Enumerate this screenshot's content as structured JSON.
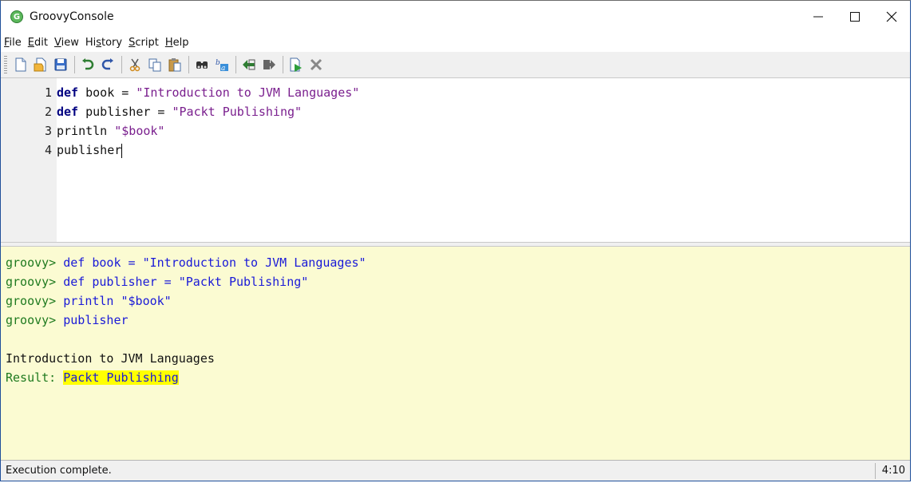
{
  "window": {
    "title": "GroovyConsole",
    "app_icon_letter": "G"
  },
  "menu": {
    "items": [
      {
        "label": "File",
        "mnemonic": "F",
        "rest": "ile"
      },
      {
        "label": "Edit",
        "mnemonic": "E",
        "rest": "dit"
      },
      {
        "label": "View",
        "mnemonic": "V",
        "rest": "iew"
      },
      {
        "label": "History",
        "mnemonic_prefix": "Hi",
        "mnemonic": "s",
        "rest": "tory"
      },
      {
        "label": "Script",
        "mnemonic": "S",
        "rest": "cript"
      },
      {
        "label": "Help",
        "mnemonic": "H",
        "rest": "elp"
      }
    ]
  },
  "toolbar": {
    "icons": [
      "new-file-icon",
      "open-file-icon",
      "save-icon",
      "undo-icon",
      "redo-icon",
      "cut-icon",
      "copy-icon",
      "paste-icon",
      "find-icon",
      "replace-icon",
      "history-previous-icon",
      "history-next-icon",
      "run-script-icon",
      "interrupt-icon"
    ]
  },
  "editor": {
    "lines": [
      {
        "num": "1",
        "kw": "def",
        "rest_plain": " book = ",
        "str": "\"Introduction to JVM Languages\""
      },
      {
        "num": "2",
        "kw": "def",
        "rest_plain": " publisher = ",
        "str": "\"Packt Publishing\""
      },
      {
        "num": "3",
        "kw": "",
        "rest_plain": "println ",
        "str": "\"$book\""
      },
      {
        "num": "4",
        "kw": "",
        "rest_plain": "publisher",
        "str": ""
      }
    ]
  },
  "output": {
    "prompt": "groovy>",
    "commands": [
      "def book = \"Introduction to JVM Languages\"",
      "def publisher = \"Packt Publishing\"",
      "println \"$book\"",
      "publisher"
    ],
    "printed": "Introduction to JVM Languages",
    "result_label": "Result: ",
    "result_value": "Packt Publishing",
    "colors": {
      "prompt": "#1f7a1f",
      "code": "#1a1ad8",
      "result_highlight": "#ffff00",
      "background": "#fbfbd2"
    }
  },
  "status": {
    "message": "Execution complete.",
    "caret_position": "4:10"
  }
}
